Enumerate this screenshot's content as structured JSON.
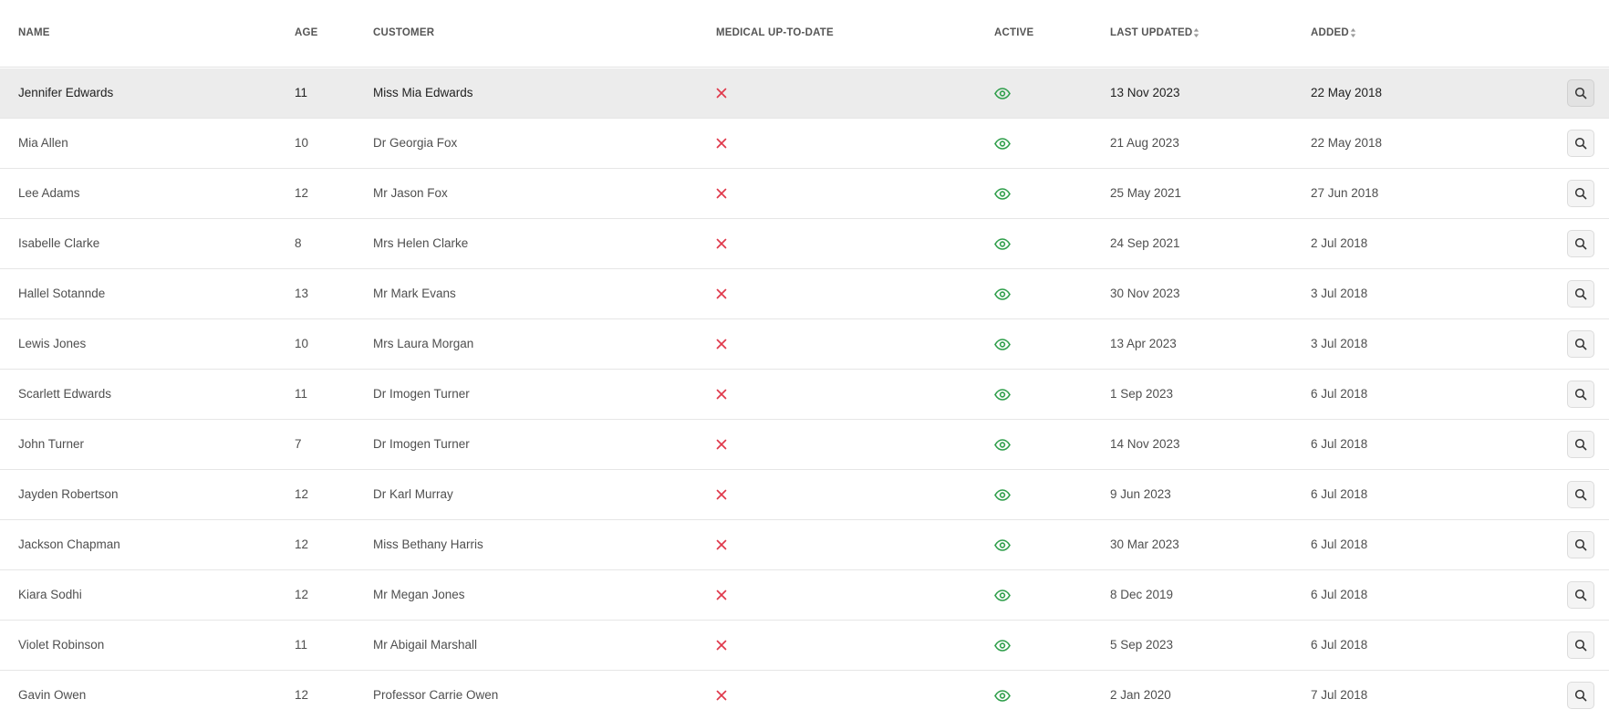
{
  "columns": {
    "name": "NAME",
    "age": "AGE",
    "customer": "CUSTOMER",
    "medical": "MEDICAL UP-TO-DATE",
    "active": "ACTIVE",
    "last_updated": "LAST UPDATED",
    "added": "ADDED"
  },
  "colors": {
    "cross": "#e0384b",
    "eye": "#2e9e4a",
    "highlight_row": "#ececec"
  },
  "icons": {
    "medical": "x-icon",
    "active": "eye-icon",
    "action": "search-icon",
    "sort": "sort-icon"
  },
  "rows": [
    {
      "name": "Jennifer Edwards",
      "age": "11",
      "customer": "Miss Mia Edwards",
      "last_updated": "13 Nov 2023",
      "added": "22 May 2018",
      "highlighted": true
    },
    {
      "name": "Mia Allen",
      "age": "10",
      "customer": "Dr Georgia Fox",
      "last_updated": "21 Aug 2023",
      "added": "22 May 2018"
    },
    {
      "name": "Lee Adams",
      "age": "12",
      "customer": "Mr Jason Fox",
      "last_updated": "25 May 2021",
      "added": "27 Jun 2018"
    },
    {
      "name": "Isabelle Clarke",
      "age": "8",
      "customer": "Mrs Helen Clarke",
      "last_updated": "24 Sep 2021",
      "added": "2 Jul 2018"
    },
    {
      "name": "Hallel Sotannde",
      "age": "13",
      "customer": "Mr Mark Evans",
      "last_updated": "30 Nov 2023",
      "added": "3 Jul 2018"
    },
    {
      "name": "Lewis Jones",
      "age": "10",
      "customer": "Mrs Laura Morgan",
      "last_updated": "13 Apr 2023",
      "added": "3 Jul 2018"
    },
    {
      "name": "Scarlett Edwards",
      "age": "11",
      "customer": "Dr Imogen Turner",
      "last_updated": "1 Sep 2023",
      "added": "6 Jul 2018"
    },
    {
      "name": "John Turner",
      "age": "7",
      "customer": "Dr Imogen Turner",
      "last_updated": "14 Nov 2023",
      "added": "6 Jul 2018"
    },
    {
      "name": "Jayden Robertson",
      "age": "12",
      "customer": "Dr Karl Murray",
      "last_updated": "9 Jun 2023",
      "added": "6 Jul 2018"
    },
    {
      "name": "Jackson Chapman",
      "age": "12",
      "customer": "Miss Bethany Harris",
      "last_updated": "30 Mar 2023",
      "added": "6 Jul 2018"
    },
    {
      "name": "Kiara Sodhi",
      "age": "12",
      "customer": "Mr Megan Jones",
      "last_updated": "8 Dec 2019",
      "added": "6 Jul 2018"
    },
    {
      "name": "Violet Robinson",
      "age": "11",
      "customer": "Mr Abigail Marshall",
      "last_updated": "5 Sep 2023",
      "added": "6 Jul 2018"
    },
    {
      "name": "Gavin Owen",
      "age": "12",
      "customer": "Professor Carrie Owen",
      "last_updated": "2 Jan 2020",
      "added": "7 Jul 2018"
    }
  ]
}
